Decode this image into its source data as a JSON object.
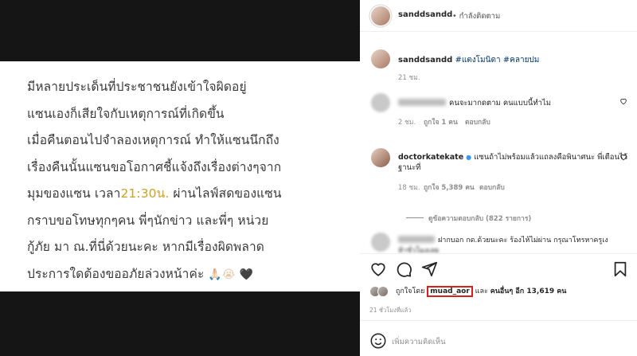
{
  "post": {
    "lines": [
      {
        "text": "มีหลายประเด็นที่ประชาชนยังเข้าใจผิดอยู่"
      },
      {
        "text": "แซนเองก็เสียใจกับเหตุการณ์ที่เกิดขึ้น"
      },
      {
        "text": "เมื่อคืนตอนไปจำลองเหตุการณ์ ทำให้แซนนึกถึง"
      },
      {
        "text": "เรื่องคืนนั้นแซนขอโอกาศชี้แจ้งถึงเรื่องต่างๆจาก"
      },
      {
        "pre": "มุมของแซน เวลา",
        "highlight": "21:30น.",
        "post": " ผ่านไลฟ์สดของแซน"
      },
      {
        "text": "กราบขอโทษทุกๆคน พี่ๆนักข่าว และพี่ๆ หน่วย"
      },
      {
        "text": "กู้ภัย มา ณ.ที่นี่ด้วยนะคะ  หากมีเรื่องผิดพลาด"
      },
      {
        "text": "ประการใดต้องขออภัยล่วงหน้าค่ะ",
        "emoji": "🙏🏻😭",
        "heart": "🖤"
      }
    ],
    "highlight_color": "#c9a227"
  },
  "header": {
    "username": "sanddsandd",
    "follow_text": "• กำลังติดตาม"
  },
  "caption": {
    "username": "sanddsandd",
    "tags": "#แตงโมนิดา #คลายปม",
    "time": "21 ชม."
  },
  "comments": [
    {
      "text": "คนจะมากดตาม คนแบบนี้ทำไม",
      "time": "2 ชม.",
      "likes": "ถูกใจ 1 คน",
      "reply": "ตอบกลับ"
    },
    {
      "username": "doctorkatekate",
      "text_line1": "แซนถ้าไม่พร้อมแล้วแถลงคือพินาศนะ พี่เตือนไว้",
      "text_line2": "ฐานะที่",
      "time": "18 ชม.",
      "likes": "ถูกใจ 5,389 คน",
      "reply": "ตอบกลับ",
      "view_replies": "ดูข้อความตอบกลับ (822 รายการ)"
    },
    {
      "text_line1": "ฝากบอก กด.ด้วยนะคะ ร้องไห้ไม่ผ่าน กรุณาโทรหาครูเง",
      "text_line2": "ห้าชั่วโมงเลย"
    }
  ],
  "likes": {
    "prefix": "ถูกใจโดย",
    "liker": "muad_aor",
    "suffix_and": "และ",
    "others": "คนอื่นๆ อีก 13,619 คน",
    "time": "21 ชั่วโมงที่แล้ว"
  },
  "add_comment": {
    "placeholder": "เพิ่มความคิดเห็น"
  },
  "colors": {
    "tag": "#00376b",
    "redbox": "#d7201e",
    "meta": "#8e8e8e"
  }
}
